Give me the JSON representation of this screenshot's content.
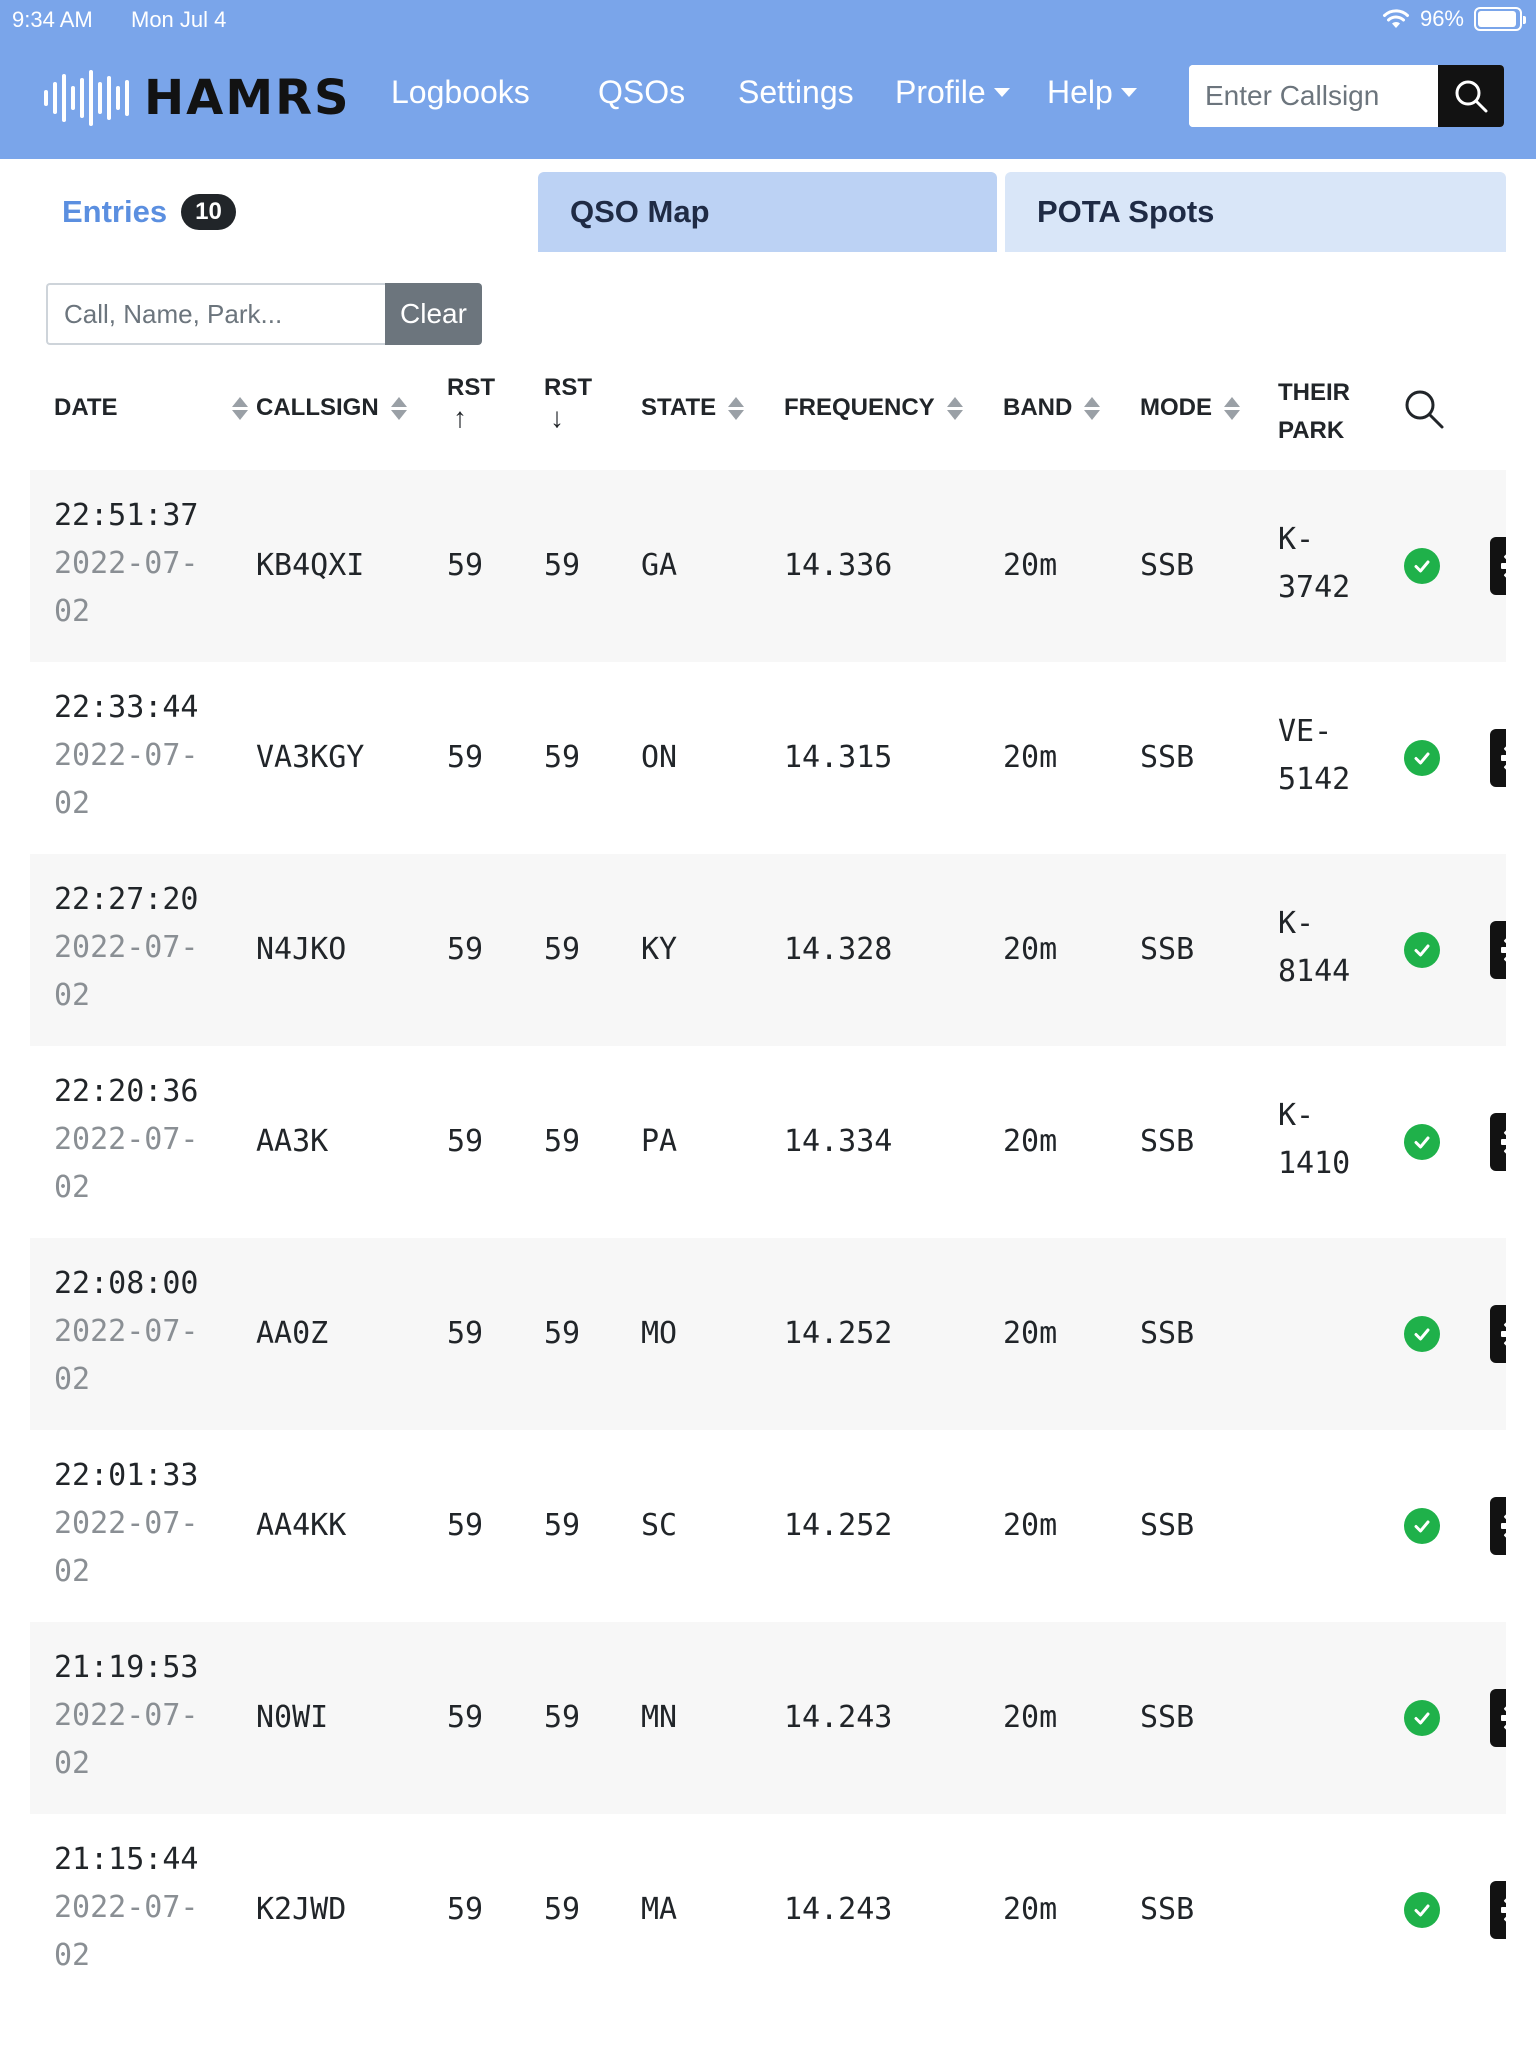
{
  "status": {
    "time": "9:34 AM",
    "date": "Mon Jul 4",
    "battery": "96%"
  },
  "brand": {
    "name": "HAMRS"
  },
  "nav": {
    "logbooks": "Logbooks",
    "qsos": "QSOs",
    "settings": "Settings",
    "profile": "Profile",
    "help": "Help"
  },
  "search": {
    "placeholder": "Enter Callsign"
  },
  "tabs": {
    "entries": "Entries",
    "entries_count": "10",
    "qso_map": "QSO Map",
    "pota_spots": "POTA Spots"
  },
  "filter": {
    "placeholder": "Call, Name, Park...",
    "clear": "Clear"
  },
  "columns": {
    "date": "DATE",
    "callsign": "CALLSIGN",
    "rst_sent": "RST",
    "rst_sent_arrow": "↑",
    "rst_rcvd": "RST",
    "rst_rcvd_arrow": "↓",
    "state": "STATE",
    "frequency": "FREQUENCY",
    "band": "BAND",
    "mode": "MODE",
    "their_park_1": "THEIR",
    "their_park_2": "PARK"
  },
  "entries": [
    {
      "time": "22:51:37",
      "date_a": "2022-07-",
      "date_b": "02",
      "callsign": "KB4QXI",
      "rst_sent": "59",
      "rst_rcvd": "59",
      "state": "GA",
      "frequency": "14.336",
      "band": "20m",
      "mode": "SSB",
      "park_a": "K-",
      "park_b": "3742"
    },
    {
      "time": "22:33:44",
      "date_a": "2022-07-",
      "date_b": "02",
      "callsign": "VA3KGY",
      "rst_sent": "59",
      "rst_rcvd": "59",
      "state": "ON",
      "frequency": "14.315",
      "band": "20m",
      "mode": "SSB",
      "park_a": "VE-",
      "park_b": "5142"
    },
    {
      "time": "22:27:20",
      "date_a": "2022-07-",
      "date_b": "02",
      "callsign": "N4JKO",
      "rst_sent": "59",
      "rst_rcvd": "59",
      "state": "KY",
      "frequency": "14.328",
      "band": "20m",
      "mode": "SSB",
      "park_a": "K-",
      "park_b": "8144"
    },
    {
      "time": "22:20:36",
      "date_a": "2022-07-",
      "date_b": "02",
      "callsign": "AA3K",
      "rst_sent": "59",
      "rst_rcvd": "59",
      "state": "PA",
      "frequency": "14.334",
      "band": "20m",
      "mode": "SSB",
      "park_a": "K-",
      "park_b": "1410"
    },
    {
      "time": "22:08:00",
      "date_a": "2022-07-",
      "date_b": "02",
      "callsign": "AA0Z",
      "rst_sent": "59",
      "rst_rcvd": "59",
      "state": "MO",
      "frequency": "14.252",
      "band": "20m",
      "mode": "SSB",
      "park_a": "",
      "park_b": ""
    },
    {
      "time": "22:01:33",
      "date_a": "2022-07-",
      "date_b": "02",
      "callsign": "AA4KK",
      "rst_sent": "59",
      "rst_rcvd": "59",
      "state": "SC",
      "frequency": "14.252",
      "band": "20m",
      "mode": "SSB",
      "park_a": "",
      "park_b": ""
    },
    {
      "time": "21:19:53",
      "date_a": "2022-07-",
      "date_b": "02",
      "callsign": "N0WI",
      "rst_sent": "59",
      "rst_rcvd": "59",
      "state": "MN",
      "frequency": "14.243",
      "band": "20m",
      "mode": "SSB",
      "park_a": "",
      "park_b": ""
    },
    {
      "time": "21:15:44",
      "date_a": "2022-07-",
      "date_b": "02",
      "callsign": "K2JWD",
      "rst_sent": "59",
      "rst_rcvd": "59",
      "state": "MA",
      "frequency": "14.243",
      "band": "20m",
      "mode": "SSB",
      "park_a": "",
      "park_b": ""
    }
  ],
  "colors": {
    "header_bg": "#7aa5ea",
    "accent": "#5b8fe0",
    "check_green": "#1fb14a",
    "dark": "#121212"
  },
  "icons": {
    "search": "search-icon",
    "check": "check-circle-icon",
    "gear": "gear-icon",
    "wifi": "wifi-icon",
    "battery": "battery-icon"
  }
}
